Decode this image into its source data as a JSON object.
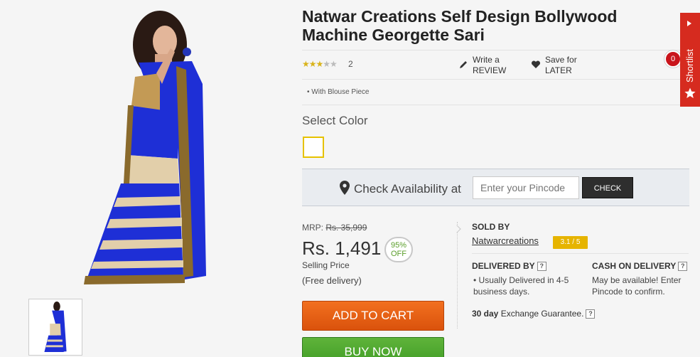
{
  "product": {
    "title": "Natwar Creations Self Design Bollywood Machine Georgette Sari",
    "rating_stars": 3,
    "rating_count": "2",
    "write_review_line1": "Write a",
    "write_review_line2": "REVIEW",
    "save_line1": "Save for",
    "save_line2": "LATER",
    "shortlist_count": "0",
    "feature_bullet": "With Blouse Piece",
    "select_color_label": "Select Color",
    "swatch_color": "#e6c200"
  },
  "availability": {
    "label": "Check Availability at",
    "pincode_placeholder": "Enter your Pincode",
    "check_button": "CHECK"
  },
  "pricing": {
    "mrp_label": "MRP:",
    "mrp_value": "Rs. 35,999",
    "price": "Rs. 1,491",
    "discount_percent": "95%",
    "discount_label": "OFF",
    "selling_price_label": "Selling Price",
    "delivery_note": "(Free delivery)",
    "add_to_cart": "ADD TO CART",
    "buy_now": "BUY NOW"
  },
  "seller": {
    "sold_by_label": "SOLD BY",
    "name": "Natwarcreations",
    "rating": "3.1 / 5",
    "delivered_by_label": "DELIVERED BY",
    "delivered_text": "Usually Delivered in 4-5 business days.",
    "cod_label": "CASH ON DELIVERY",
    "cod_text": "May be available! Enter Pincode to confirm.",
    "exchange_bold": "30 day",
    "exchange_text": " Exchange Guarantee.",
    "help_mark": "?"
  },
  "shortlist": {
    "label": "Shortlist"
  },
  "colors": {
    "accent_orange": "#da520c",
    "buy_green": "#3f9c25",
    "shortlist_red": "#d62b1f",
    "rating_gold": "#e6b400"
  }
}
